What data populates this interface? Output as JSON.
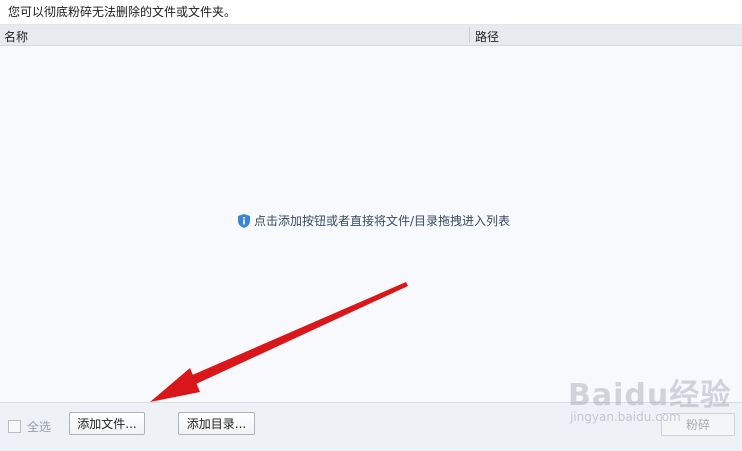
{
  "description": "您可以彻底粉碎无法删除的文件或文件夹。",
  "list": {
    "columns": [
      "名称",
      "路径"
    ],
    "empty_hint": "点击添加按钮或者直接将文件/目录拖拽进入列表"
  },
  "footer": {
    "select_all_label": "全选",
    "add_file_label": "添加文件...",
    "add_dir_label": "添加目录...",
    "shred_label": "粉碎"
  },
  "watermark": {
    "brand": "Baidu经验",
    "url": "jingyan.baidu.com"
  },
  "colors": {
    "arrow": "#d9171b",
    "info_icon": "#3a86d4",
    "header_bg": "#e7eaef",
    "list_bg": "#f7f9fd"
  }
}
